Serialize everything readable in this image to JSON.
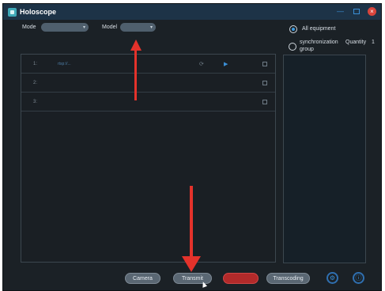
{
  "window": {
    "title": "Holoscope",
    "controls": {
      "minimize": "—",
      "close": "×"
    }
  },
  "toolbar": {
    "mode_label": "Mode",
    "mode_value": "",
    "model_label": "Model",
    "model_value": ""
  },
  "rows": [
    {
      "num": "1:",
      "address": "rtsp://..."
    },
    {
      "num": "2:",
      "address": ""
    },
    {
      "num": "3:",
      "address": ""
    }
  ],
  "sidebar": {
    "all_equipment_label": "All equipment",
    "all_equipment_checked": true,
    "sync_group_label_line1": "synchronization",
    "sync_group_label_line2": "group",
    "quantity_label": "Quantity",
    "quantity_value": "1",
    "device_item": ""
  },
  "actions": {
    "camera_label": "Camera",
    "transmit_label": "Transmit",
    "record_label": "",
    "transcoding_label": "Transcoding"
  },
  "icons": {
    "app": "holoscope-app-icon",
    "refresh": "refresh-icon",
    "play": "play-icon",
    "settings": "settings-icon",
    "info": "info-icon"
  },
  "colors": {
    "accent": "#3b8fd6",
    "record": "#b22a2a",
    "annotation_arrow": "#e4322b",
    "titlebar": "#1d3347",
    "background": "#1b2126"
  }
}
